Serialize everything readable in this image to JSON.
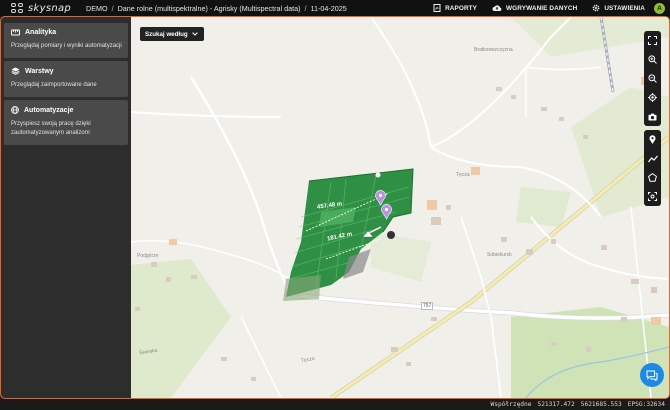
{
  "app": {
    "logo_text": "skysnap",
    "breadcrumb": [
      "DEMO",
      "Dane rolne (multispektralne) - Agrisky (Multispectral data)",
      "11-04-2025"
    ],
    "separator": "/"
  },
  "nav": {
    "reports": "RAPORTY",
    "upload": "WGRYWANIE DANYCH",
    "settings": "USTAWIENIA",
    "avatar_letter": "A"
  },
  "sidebar": {
    "items": [
      {
        "title": "Analityka",
        "desc": "Przeglądaj pomiary i wyniki automatyzacji",
        "icon": "ruler-icon"
      },
      {
        "title": "Warstwy",
        "desc": "Przeglądaj zaimportowane dane",
        "icon": "layers-icon"
      },
      {
        "title": "Automatyzacje",
        "desc": "Przyspiesz swoją pracę dzięki zautomatyzowanym analizom",
        "icon": "globe-icon"
      }
    ]
  },
  "map": {
    "search_label": "Szukaj według",
    "labels": {
      "bratkowszczyzna": "Bratkowszczyzna",
      "sobiekursk": "Sobiekursk",
      "podgorze": "Podgórze",
      "road_number": "757",
      "tecza": "Tęcza",
      "swinska": "Świnska"
    },
    "measurements": [
      "457.48 m",
      "181.42 m"
    ],
    "tools_top": [
      "fullscreen-icon",
      "zoom-in-icon",
      "zoom-out-icon",
      "locate-icon",
      "camera-icon"
    ],
    "tools_draw": [
      "marker-icon",
      "polyline-icon",
      "polygon-icon",
      "scan-icon"
    ]
  },
  "status": {
    "label": "Współrzędne",
    "x": "521317.472",
    "y": "5621685.553",
    "epsg": "EPSG:32634"
  },
  "colors": {
    "accent": "#e8632a",
    "avatar": "#8fbf2f",
    "chat": "#1e88e5",
    "field": "#2e8f45"
  }
}
